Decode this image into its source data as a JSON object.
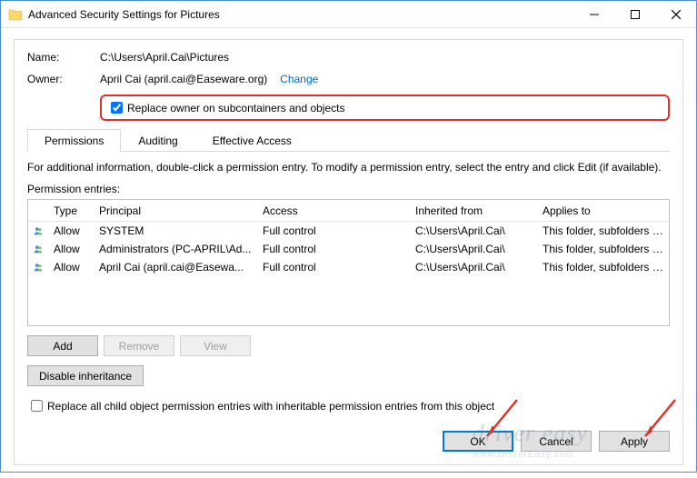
{
  "window_title": "Advanced Security Settings for Pictures",
  "labels": {
    "name": "Name:",
    "owner": "Owner:",
    "change_link": "Change",
    "replace_owner": "Replace owner on subcontainers and objects",
    "info_line": "For additional information, double-click a permission entry. To modify a permission entry, select the entry and click Edit (if available).",
    "entries_label": "Permission entries:",
    "replace_all": "Replace all child object permission entries with inheritable permission entries from this object"
  },
  "name_value": "C:\\Users\\April.Cai\\Pictures",
  "owner_value": "April Cai (april.cai@Easeware.org)",
  "tabs": [
    "Permissions",
    "Auditing",
    "Effective Access"
  ],
  "active_tab": 0,
  "columns": {
    "type": "Type",
    "principal": "Principal",
    "access": "Access",
    "inherited": "Inherited from",
    "applies": "Applies to"
  },
  "entries": [
    {
      "type": "Allow",
      "principal": "SYSTEM",
      "access": "Full control",
      "inherited": "C:\\Users\\April.Cai\\",
      "applies": "This folder, subfolders and files"
    },
    {
      "type": "Allow",
      "principal": "Administrators (PC-APRIL\\Ad...",
      "access": "Full control",
      "inherited": "C:\\Users\\April.Cai\\",
      "applies": "This folder, subfolders and files"
    },
    {
      "type": "Allow",
      "principal": "April Cai (april.cai@Easewa...",
      "access": "Full control",
      "inherited": "C:\\Users\\April.Cai\\",
      "applies": "This folder, subfolders and files"
    }
  ],
  "buttons": {
    "add": "Add",
    "remove": "Remove",
    "view": "View",
    "disable_inh": "Disable inheritance",
    "ok": "OK",
    "cancel": "Cancel",
    "apply": "Apply"
  },
  "watermark": "driver easy",
  "watermark_sub": "www.DriverEasy.com"
}
